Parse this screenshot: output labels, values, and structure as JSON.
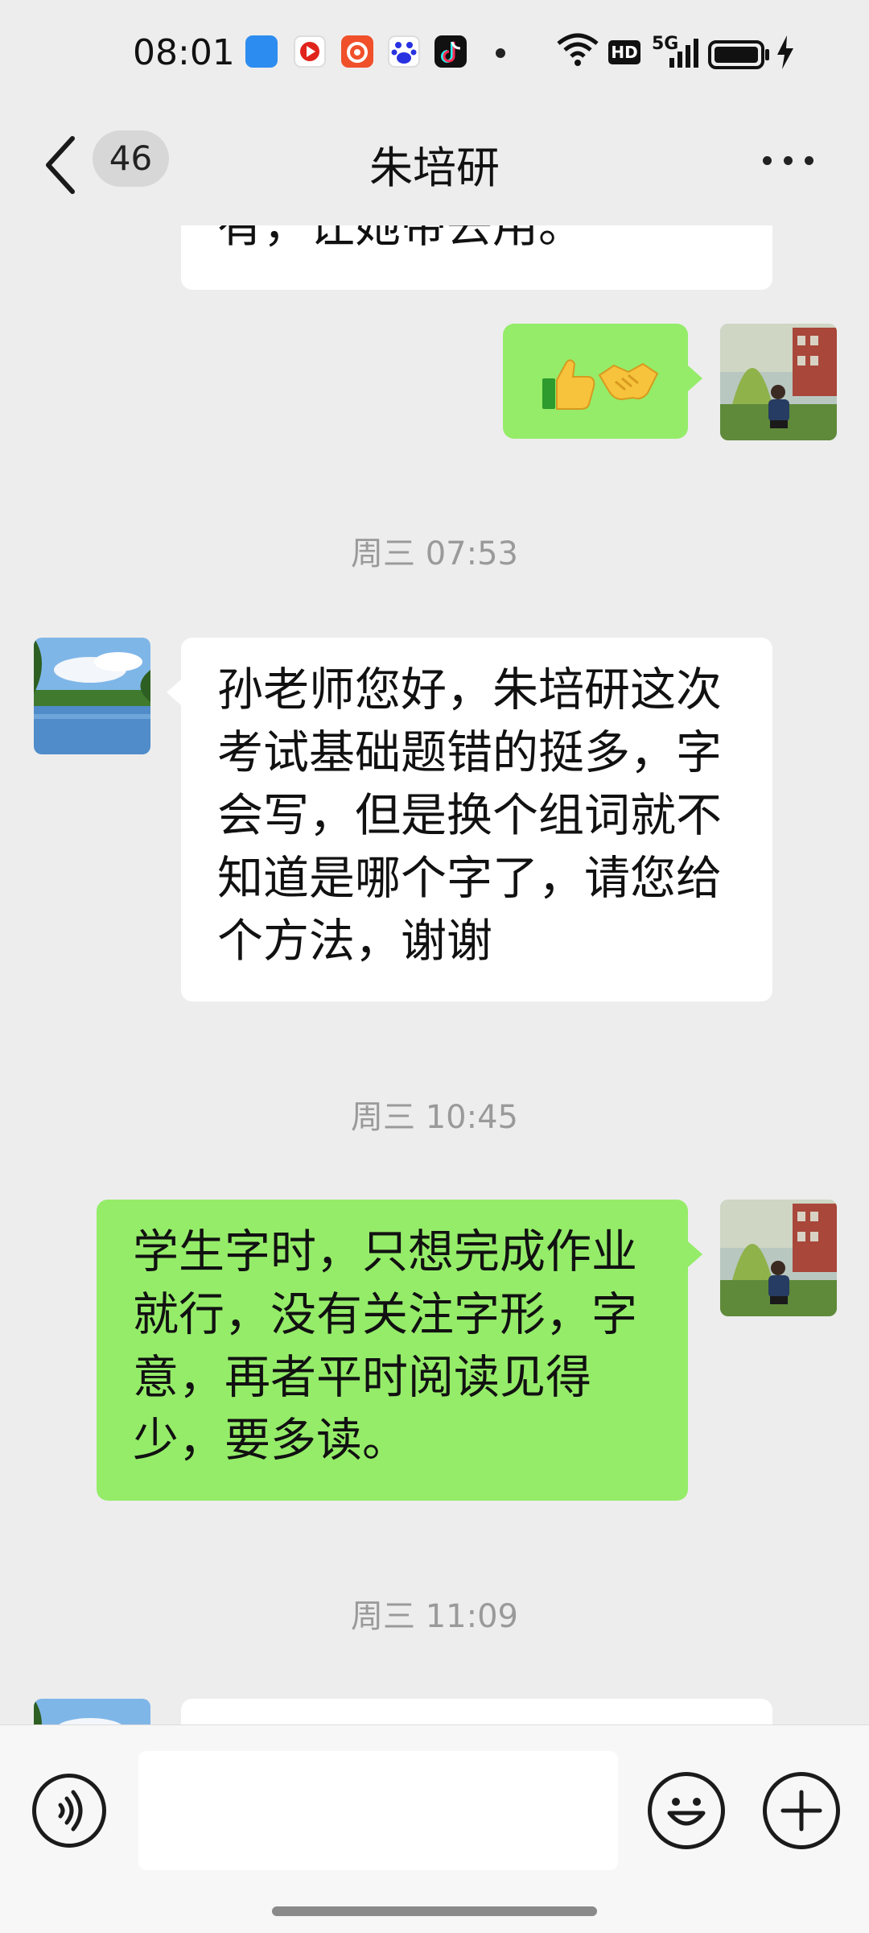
{
  "status_bar": {
    "time": "08:01",
    "app_icons": [
      "message-icon",
      "video-icon",
      "weibo-icon",
      "baidu-icon",
      "douyin-icon"
    ],
    "hd_label": "HD",
    "network_label": "5G"
  },
  "header": {
    "back_label": "<",
    "unread_count": "46",
    "title": "朱培研",
    "more_label": "..."
  },
  "messages": [
    {
      "side": "in",
      "text": "有，让她带去用。"
    },
    {
      "side": "out",
      "emoji": "👍🤝"
    },
    {
      "timestamp": "周三 07:53"
    },
    {
      "side": "in",
      "lines": [
        "孙老师您好，朱培研这次",
        "考试基础题错的挺多，字",
        "会写，但是换个组词就不",
        "知道是哪个字了，请您给",
        "个方法，谢谢"
      ]
    },
    {
      "timestamp": "周三 10:45"
    },
    {
      "side": "out",
      "lines": [
        "学生字时，只想完成作业",
        "就行，没有关注字形，字",
        "意，再者平时阅读见得",
        "少，要多读。"
      ]
    },
    {
      "timestamp": "周三 11:09"
    }
  ],
  "input_bar": {
    "input_value": "",
    "voice_icon": "voice-icon",
    "emoji_icon": "emoji-icon",
    "plus_icon": "plus-icon"
  },
  "colors": {
    "background": "#ededed",
    "outgoing_bubble": "#95ec69",
    "incoming_bubble": "#ffffff",
    "timestamp_text": "#9a9a9a"
  }
}
